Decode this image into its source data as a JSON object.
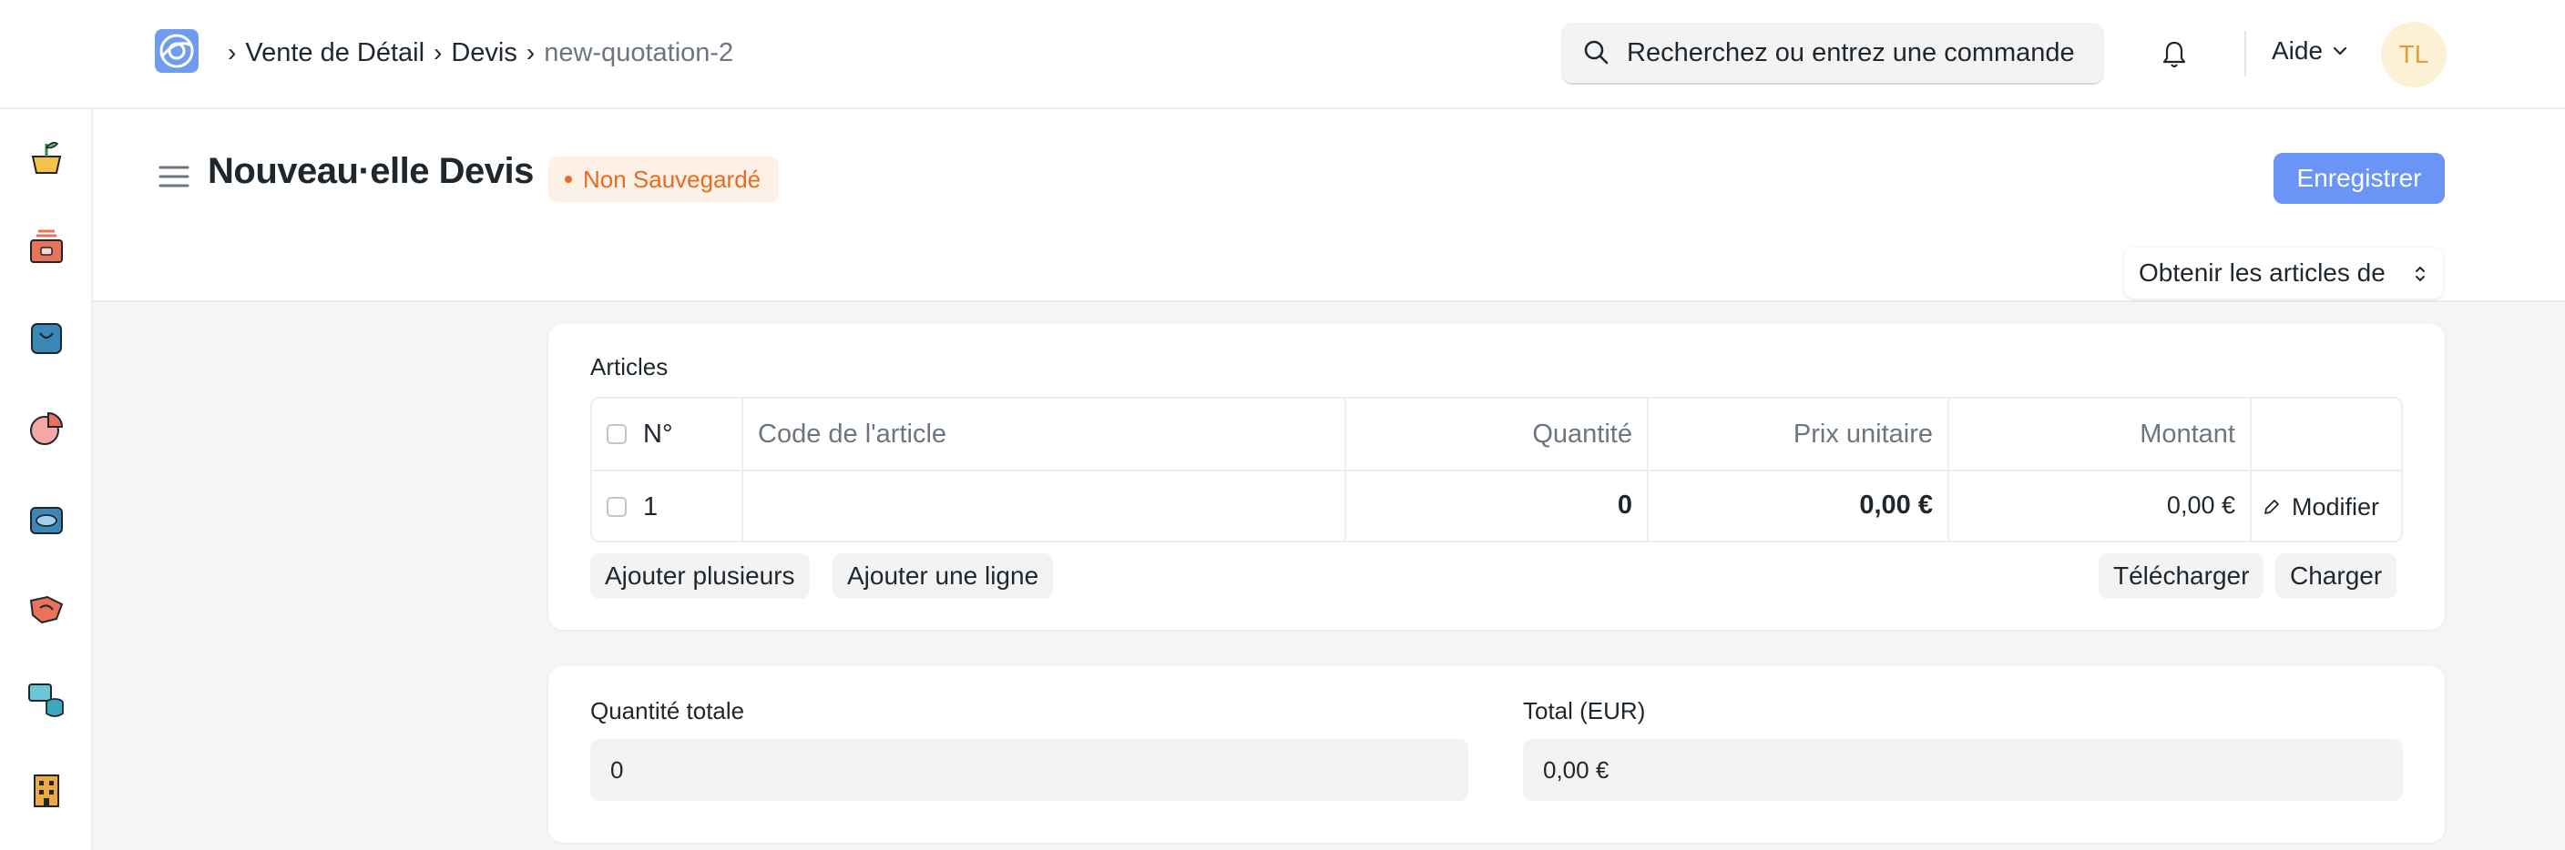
{
  "navbar": {
    "breadcrumbs": [
      "Vente de Détail",
      "Devis",
      "new-quotation-2"
    ],
    "search_placeholder": "Recherchez ou entrez une commande",
    "help_label": "Aide",
    "avatar_initials": "TL"
  },
  "sidebar": {
    "icons": [
      "plant-pot-icon",
      "cash-register-icon",
      "shopping-bag-icon",
      "pie-chart-icon",
      "wallet-icon",
      "handshake-icon",
      "database-chat-icon",
      "building-icon"
    ]
  },
  "page": {
    "title": "Nouveau·elle Devis",
    "status_badge": "Non Sauvegardé",
    "save_button": "Enregistrer",
    "get_items_label": "Obtenir les articles de"
  },
  "items_table": {
    "section_label": "Articles",
    "columns": [
      "N°",
      "Code de l'article",
      "Quantité",
      "Prix unitaire",
      "Montant"
    ],
    "rows": [
      {
        "no": "1",
        "item_code": "",
        "qty": "0",
        "rate": "0,00 €",
        "amount": "0,00 €",
        "edit_label": "Modifier"
      }
    ],
    "add_multiple": "Ajouter plusieurs",
    "add_row": "Ajouter une ligne",
    "download": "Télécharger",
    "upload": "Charger"
  },
  "totals": {
    "total_qty_label": "Quantité totale",
    "total_qty_value": "0",
    "total_label": "Total (EUR)",
    "total_value": "0,00 €"
  },
  "colors": {
    "primary": "#6a94f5",
    "badge_text": "#e86c1f",
    "badge_bg": "#fdf0e6",
    "avatar_bg": "#fcf0d6"
  }
}
